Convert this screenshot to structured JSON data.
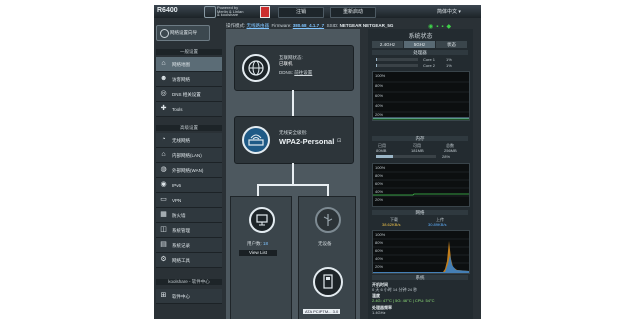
{
  "header": {
    "model": "R6400",
    "powered_by": [
      "Powered by",
      "Merlin & Linlan",
      "& koolshare"
    ],
    "buttons": [
      "注销",
      "重新启动"
    ],
    "language": "简体中文",
    "info": {
      "op_mode_label": "操作模式:",
      "op_mode_value": "无线路由器",
      "firmware_label": "Firmware:",
      "firmware_value": "380.68_4.1.7_7",
      "ssid_label": "SSID:",
      "ssid_values": [
        "NETGEAR",
        "NETGEAR_5G"
      ]
    }
  },
  "sidebar": {
    "quick_setup": "网络设置向导",
    "sections": [
      {
        "title": "一般设置",
        "items": [
          {
            "icon": "map-icon",
            "label": "网络地图",
            "active": true
          },
          {
            "icon": "guest-icon",
            "label": "访客网络"
          },
          {
            "icon": "dsl-icon",
            "label": "DNS 相关设置"
          },
          {
            "icon": "tools-icon",
            "label": "Tools"
          }
        ]
      },
      {
        "title": "高级设置",
        "items": [
          {
            "icon": "wireless-icon",
            "label": "无线网络"
          },
          {
            "icon": "lan-icon",
            "label": "内部网络(LAN)"
          },
          {
            "icon": "wan-icon",
            "label": "外部网络(WAN)"
          },
          {
            "icon": "ipv6-icon",
            "label": "IPv6"
          },
          {
            "icon": "vpn-icon",
            "label": "VPN"
          },
          {
            "icon": "firewall-icon",
            "label": "防火墙"
          },
          {
            "icon": "admin-icon",
            "label": "系统管理"
          },
          {
            "icon": "log-icon",
            "label": "系统记录"
          },
          {
            "icon": "network-tools-icon",
            "label": "网络工具"
          }
        ]
      },
      {
        "title": "koolshare - 软件中心",
        "items": [
          {
            "icon": "software-center-icon",
            "label": "软件中心"
          }
        ]
      }
    ]
  },
  "map": {
    "internet": {
      "label": "互联网状态:",
      "status": "已联机",
      "ddns": "DDNS:",
      "ddns_link": "前往设置"
    },
    "wireless": {
      "label": "无线安全级别:",
      "security": "WPA2-Personal"
    },
    "clients": {
      "label": "用户数:",
      "count": "18",
      "button": "View List"
    },
    "usb": {
      "label": "无设备"
    },
    "usb2": {
      "label": "ATA PCIPTM... 3.0"
    }
  },
  "status_panel": {
    "title": "系统状态",
    "tabs": [
      "2.4GHz",
      "5GHz",
      "状态"
    ],
    "cpu": {
      "title": "处理器",
      "cores": [
        {
          "name": "Core 1",
          "pct": "1%"
        },
        {
          "name": "Core 2",
          "pct": "1%"
        }
      ],
      "y_labels": [
        "100%",
        "80%",
        "60%",
        "40%",
        "20%"
      ]
    },
    "memory": {
      "title": "内存",
      "cols": [
        "已用",
        "可用",
        "总数"
      ],
      "vals": [
        "80MB",
        "181MB",
        "256MB"
      ],
      "pct": "28%",
      "pct_value": 0.28
    },
    "network": {
      "title": "网络",
      "labels": [
        "下载",
        "上传"
      ],
      "vals": [
        "38.62KB/s",
        "30.89KB/s"
      ]
    },
    "system": {
      "title": "系统",
      "uptime_label": "开机时间",
      "uptime": "0 天 6 小时 14 分钟 24 秒",
      "temp_label": "温度",
      "temp": "2.4G: 47°C | 5G: 46°C | CPU: 54°C",
      "proc_label": "处理器频率",
      "proc": "1.4GHz"
    }
  },
  "colors": {
    "accent": "#3fd14a",
    "frame": "#2a3136",
    "graph_line": "#2fa0ff"
  }
}
